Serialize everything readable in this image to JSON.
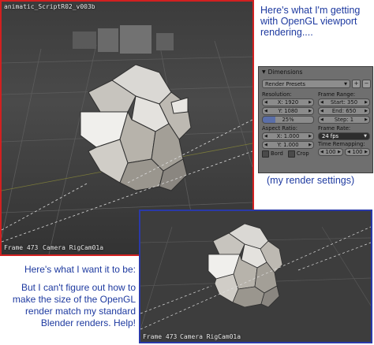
{
  "viewport_top": {
    "header_text": "animatic_ScriptR02_v003b",
    "frame_label": "Frame 473",
    "camera_label": "Camera RigCam01a"
  },
  "viewport_bottom": {
    "frame_label": "Frame 473",
    "camera_label": "Camera RigCam01a"
  },
  "annotations": {
    "top_note": [
      "Here's what I'm getting",
      "with OpenGL viewport",
      "rendering...."
    ],
    "settings_caption": "(my render settings)",
    "want_note": [
      "Here's what I want it to be:",
      "",
      "But I can't figure out how to",
      "make the size of the OpenGL",
      "render match my standard",
      "Blender renders.  Help!"
    ]
  },
  "panel": {
    "title": "Dimensions",
    "presets": "Render Presets",
    "add_symbol": "+",
    "remove_symbol": "−",
    "resolution_label": "Resolution:",
    "res_x": "X: 1920",
    "res_y": "Y: 1080",
    "res_percent": "25%",
    "res_percent_value": 0.25,
    "frame_range_label": "Frame Range:",
    "start": "Start: 350",
    "end": "End: 650",
    "step": "Step: 1",
    "aspect_label": "Aspect Ratio:",
    "asp_x": "X: 1.000",
    "asp_y": "Y: 1.000",
    "frame_rate_label": "Frame Rate:",
    "fps": "24 fps",
    "time_remap_label": "Time Remapping:",
    "remap_old": "100",
    "remap_new": "100",
    "bord_label": "Bord",
    "crop_label": "Crop"
  },
  "colors": {
    "annotation_text": "#1e3aa0",
    "top_border": "#d22020",
    "bottom_border": "#2a39a8",
    "viewport_bg": "#3a3a3a"
  }
}
